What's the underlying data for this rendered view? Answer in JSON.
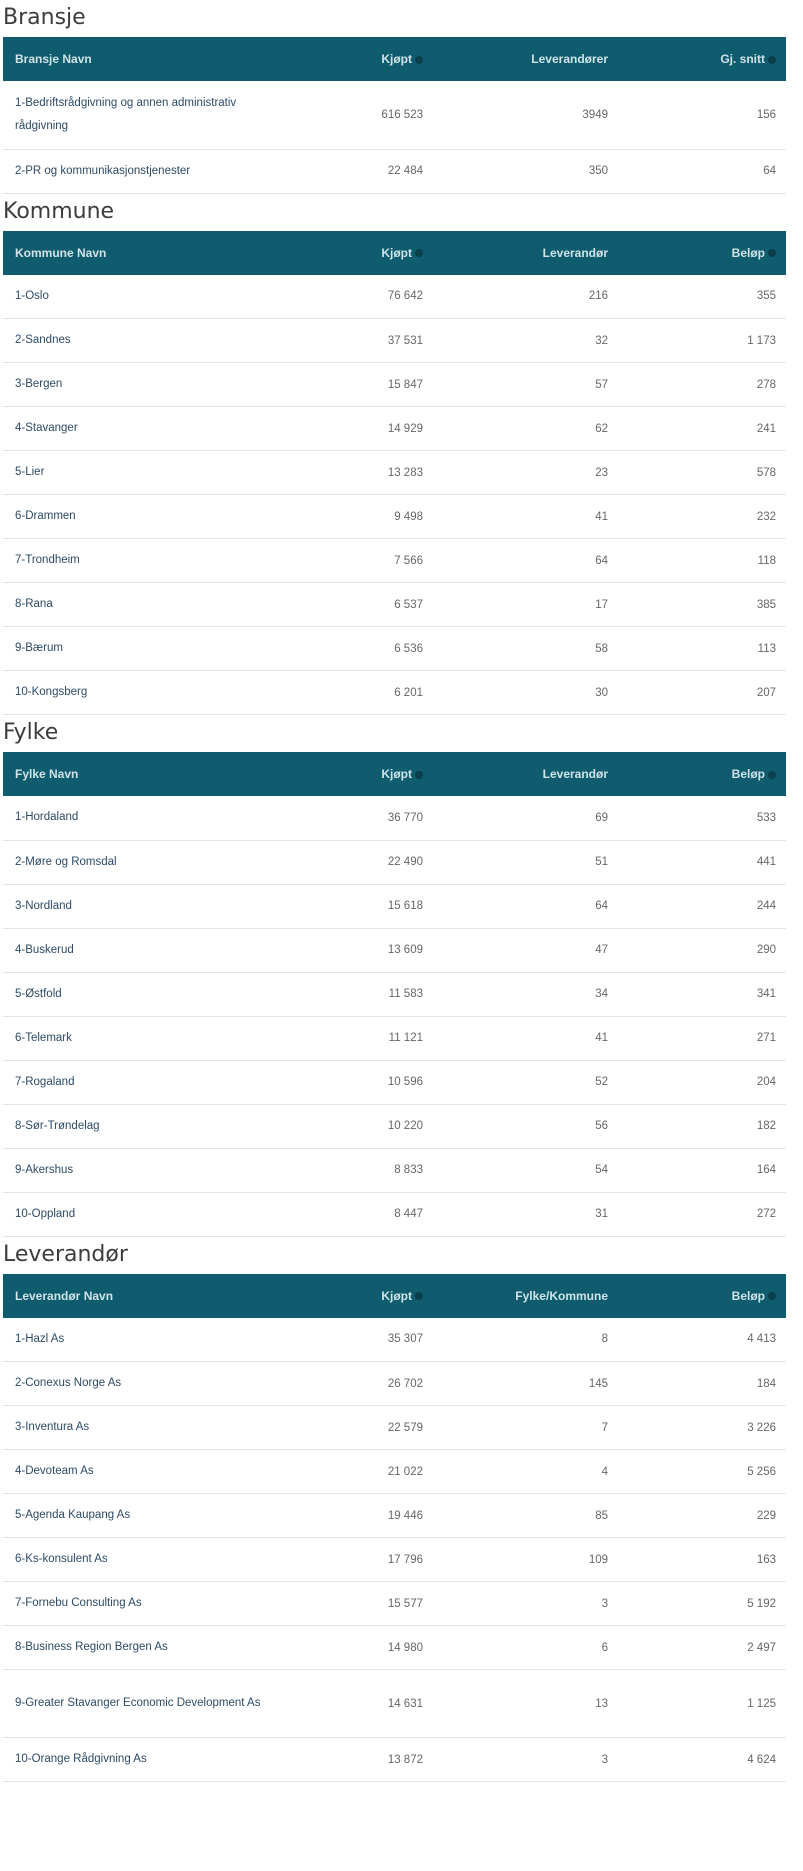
{
  "sections": [
    {
      "title": "Bransje",
      "headers": [
        "Bransje Navn",
        "Kjøpt",
        "Leverandører",
        "Gj. snitt"
      ],
      "rows": [
        [
          "1-Bedriftsrådgivning og annen administrativ rådgivning",
          "616 523",
          "3949",
          "156"
        ],
        [
          "2-PR og kommunikasjonstjenester",
          "22 484",
          "350",
          "64"
        ]
      ]
    },
    {
      "title": "Kommune",
      "headers": [
        "Kommune Navn",
        "Kjøpt",
        "Leverandør",
        "Beløp"
      ],
      "rows": [
        [
          "1-Oslo",
          "76 642",
          "216",
          "355"
        ],
        [
          "2-Sandnes",
          "37 531",
          "32",
          "1 173"
        ],
        [
          "3-Bergen",
          "15 847",
          "57",
          "278"
        ],
        [
          "4-Stavanger",
          "14 929",
          "62",
          "241"
        ],
        [
          "5-Lier",
          "13 283",
          "23",
          "578"
        ],
        [
          "6-Drammen",
          "9 498",
          "41",
          "232"
        ],
        [
          "7-Trondheim",
          "7 566",
          "64",
          "118"
        ],
        [
          "8-Rana",
          "6 537",
          "17",
          "385"
        ],
        [
          "9-Bærum",
          "6 536",
          "58",
          "113"
        ],
        [
          "10-Kongsberg",
          "6 201",
          "30",
          "207"
        ]
      ]
    },
    {
      "title": "Fylke",
      "headers": [
        "Fylke Navn",
        "Kjøpt",
        "Leverandør",
        "Beløp"
      ],
      "rows": [
        [
          "1-Hordaland",
          "36 770",
          "69",
          "533"
        ],
        [
          "2-Møre og Romsdal",
          "22 490",
          "51",
          "441"
        ],
        [
          "3-Nordland",
          "15 618",
          "64",
          "244"
        ],
        [
          "4-Buskerud",
          "13 609",
          "47",
          "290"
        ],
        [
          "5-Østfold",
          "11 583",
          "34",
          "341"
        ],
        [
          "6-Telemark",
          "11 121",
          "41",
          "271"
        ],
        [
          "7-Rogaland",
          "10 596",
          "52",
          "204"
        ],
        [
          "8-Sør-Trøndelag",
          "10 220",
          "56",
          "182"
        ],
        [
          "9-Akershus",
          "8 833",
          "54",
          "164"
        ],
        [
          "10-Oppland",
          "8 447",
          "31",
          "272"
        ]
      ]
    },
    {
      "title": "Leverandør",
      "headers": [
        "Leverandør Navn",
        "Kjøpt",
        "Fylke/Kommune",
        "Beløp"
      ],
      "rows": [
        [
          "1-Hazl As",
          "35 307",
          "8",
          "4 413"
        ],
        [
          "2-Conexus Norge As",
          "26 702",
          "145",
          "184"
        ],
        [
          "3-Inventura As",
          "22 579",
          "7",
          "3 226"
        ],
        [
          "4-Devoteam As",
          "21 022",
          "4",
          "5 256"
        ],
        [
          "5-Agenda Kaupang As",
          "19 446",
          "85",
          "229"
        ],
        [
          "6-Ks-konsulent As",
          "17 796",
          "109",
          "163"
        ],
        [
          "7-Fornebu Consulting As",
          "15 577",
          "3",
          "5 192"
        ],
        [
          "8-Business Region Bergen As",
          "14 980",
          "6",
          "2 497"
        ],
        [
          "9-Greater Stavanger Economic Development As",
          "14 631",
          "13",
          "1 125"
        ],
        [
          "10-Orange Rådgivning As",
          "13 872",
          "3",
          "4 624"
        ]
      ]
    }
  ]
}
